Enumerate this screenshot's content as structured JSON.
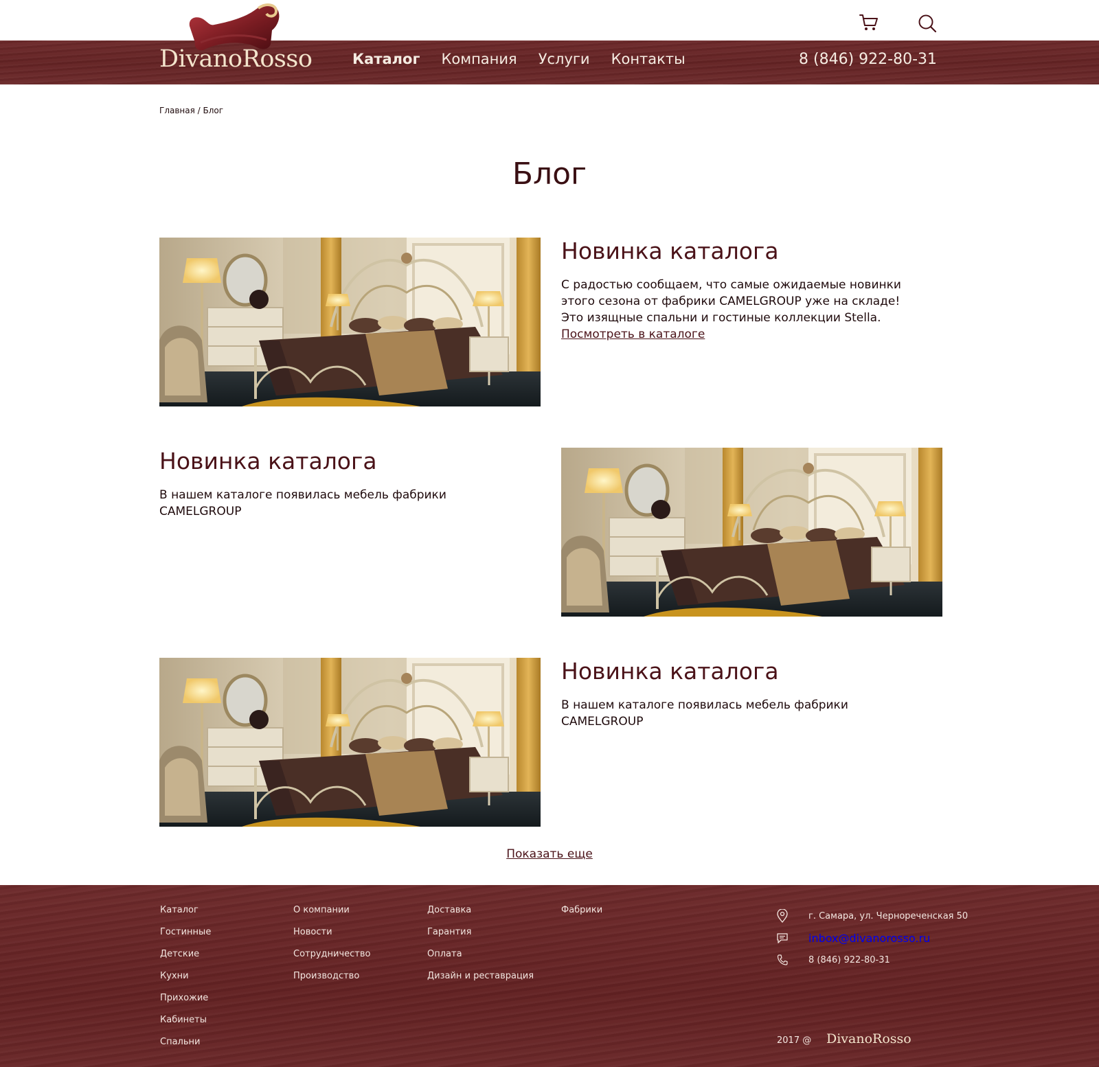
{
  "header": {
    "logo_text": "DivanoRosso",
    "nav": [
      {
        "label": "Каталог",
        "active": true
      },
      {
        "label": "Компания",
        "active": false
      },
      {
        "label": "Услуги",
        "active": false
      },
      {
        "label": "Контакты",
        "active": false
      }
    ],
    "phone": "8 (846) 922-80-31",
    "icons": [
      "cart-icon",
      "search-icon"
    ]
  },
  "breadcrumb": {
    "items": [
      "Главная",
      "Блог"
    ],
    "separator": " / "
  },
  "page_title": "Блог",
  "posts": [
    {
      "title": "Новинка каталога",
      "lines": [
        "С радостью сообщаем, что  самые ожидаемые новинки этого сезона от фабрики CAMELGROUP уже на складе!",
        "Это изящные спальни и гостиные коллекции Stella."
      ],
      "link": "Посмотреть в каталоге"
    },
    {
      "title": "Новинка каталога",
      "lines": [
        "В нашем каталоге появилась мебель фабрики CAMELGROUP"
      ]
    },
    {
      "title": "Новинка каталога",
      "lines": [
        "В нашем каталоге появилась мебель фабрики CAMELGROUP"
      ]
    }
  ],
  "show_more": "Показать еще",
  "footer": {
    "columns": [
      [
        "Каталог",
        "Гостинные",
        "Детские",
        "Кухни",
        "Прихожие",
        "Кабинеты",
        "Спальни"
      ],
      [
        "О компании",
        "Новости",
        "Сотрудничество",
        "Производство"
      ],
      [
        "Доставка",
        "Гарантия",
        "Оплата",
        "Дизайн и реставрация"
      ],
      [
        "Фабрики"
      ]
    ],
    "contacts": [
      {
        "icon": "location-pin-icon",
        "text": "г. Самара, ул. Чернореченская 50"
      },
      {
        "icon": "message-icon",
        "text": "inbox@divanorosso.ru"
      },
      {
        "icon": "phone-icon",
        "text": "8 (846) 922-80-31"
      }
    ],
    "copyright": "2017 @",
    "logo_text": "DivanoRosso"
  },
  "colors": {
    "brand_dark_red": "#662526",
    "title_color": "#4a1218",
    "footer_text": "#f3e6e0"
  }
}
